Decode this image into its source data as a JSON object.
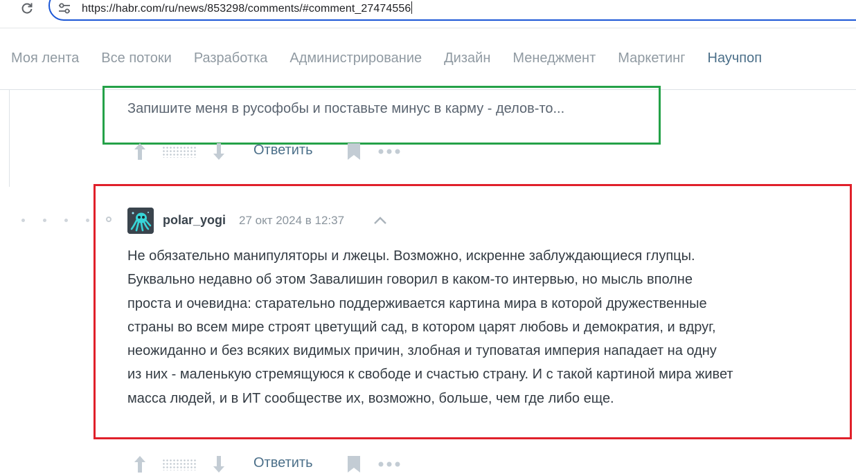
{
  "browser": {
    "url": "https://habr.com/ru/news/853298/comments/#comment_27474556",
    "accent": "#1a56d6"
  },
  "nav": {
    "items": [
      {
        "label": "Моя лента",
        "active": false
      },
      {
        "label": "Все потоки",
        "active": false
      },
      {
        "label": "Разработка",
        "active": false
      },
      {
        "label": "Администрирование",
        "active": false
      },
      {
        "label": "Дизайн",
        "active": false
      },
      {
        "label": "Менеджмент",
        "active": false
      },
      {
        "label": "Маркетинг",
        "active": false
      },
      {
        "label": "Научпоп",
        "active": true
      }
    ]
  },
  "previous_comment": {
    "text": "Запишите меня в русофобы и поставьте минус в карму - делов-то...",
    "reply_label": "Ответить",
    "highlight_color": "#24a148"
  },
  "comment": {
    "author": "polar_yogi",
    "time": "27 окт 2024 в 12:37",
    "avatar_icon": "octopus-avatar-icon",
    "highlight_color": "#e0202a",
    "lines": [
      "Не обязательно манипуляторы и лжецы. Возможно, искренне заблуждающиеся глупцы.",
      "Буквально недавно об этом Завалишин говорил в каком-то интервью, но мысль вполне",
      "проста и очевидна: старательно поддерживается картина мира в которой дружественные",
      "страны во всем мире строят цветущий сад, в котором царят любовь и демократия, и вдруг,",
      "неожиданно и без всяких видимых причин, злобная и туповатая империя нападает на одну",
      "из них - маленькую стремящуюся к свободе и счастью страну. И с такой картиной мира живет",
      "масса людей, и в ИТ сообществе их, возможно, больше, чем где либо еще."
    ],
    "reply_label": "Ответить"
  },
  "icons": {
    "reload": "reload-icon",
    "site_info": "site-info-icon",
    "vote_up": "arrow-up-icon",
    "vote_down": "arrow-down-icon",
    "bookmark": "bookmark-icon",
    "more": "more-dots-icon",
    "collapse": "chevron-up-icon"
  }
}
